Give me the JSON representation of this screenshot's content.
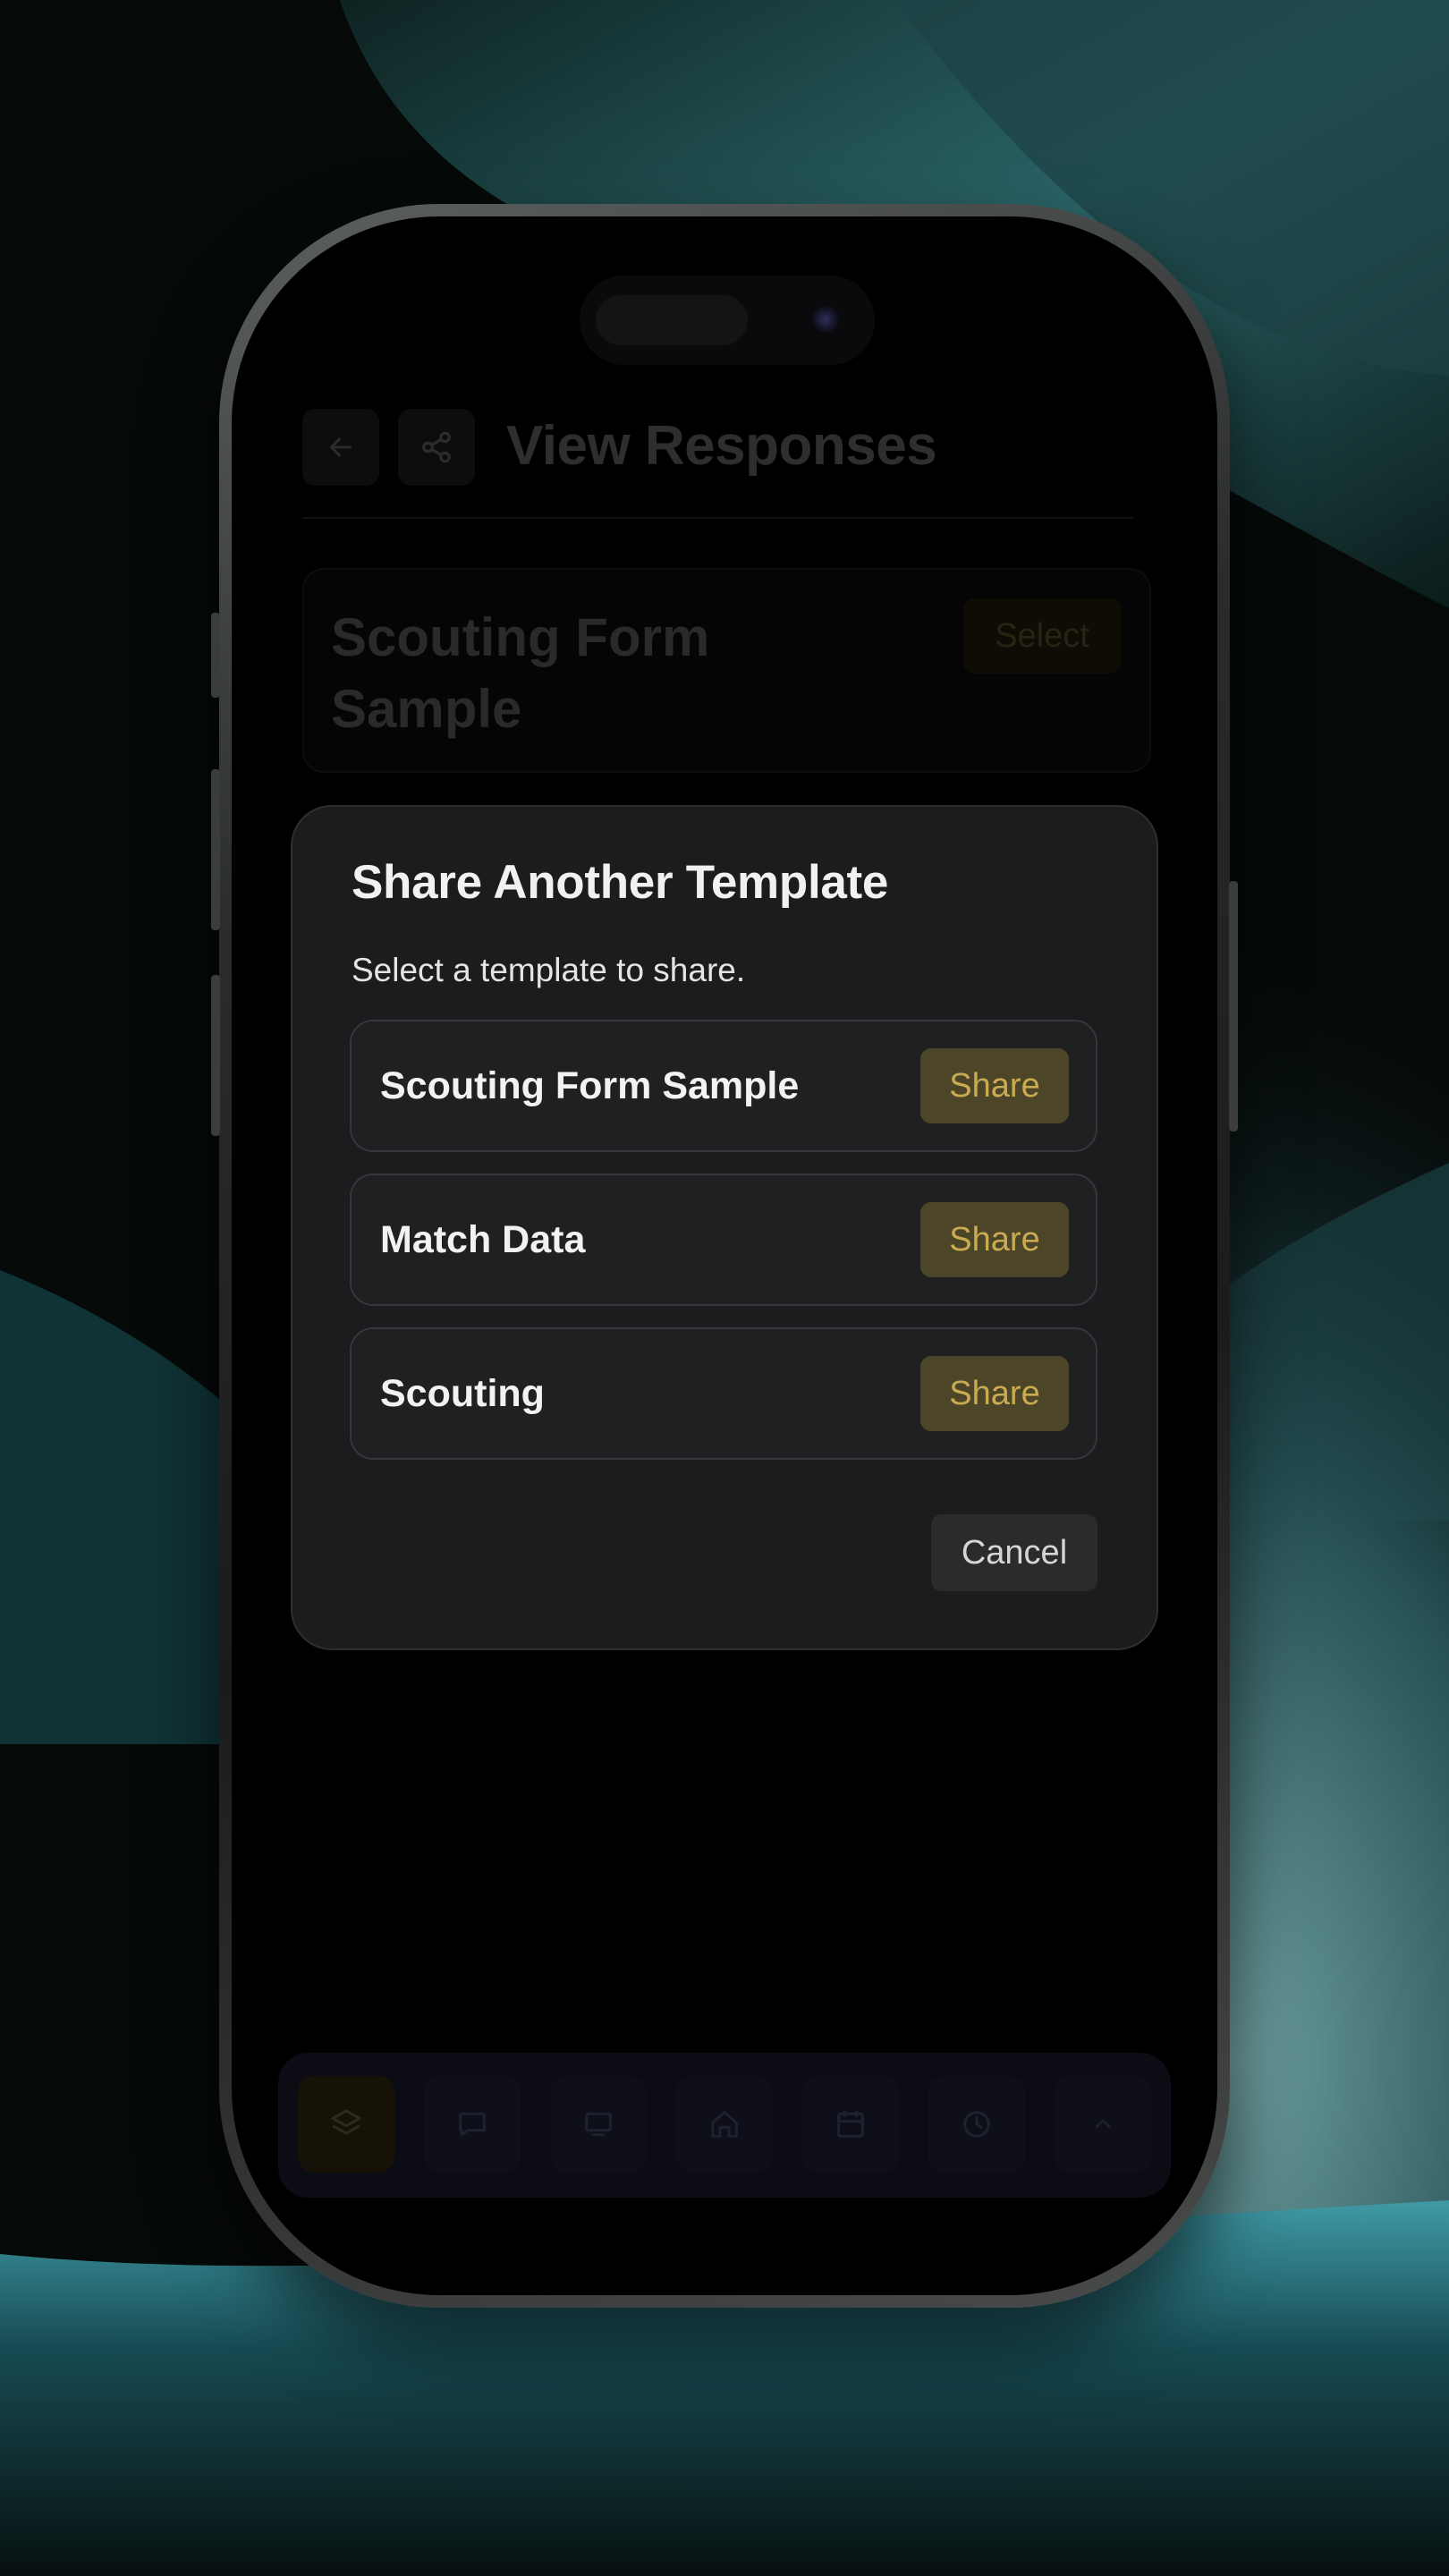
{
  "background_app": {
    "page_title": "View Responses",
    "back_icon": "arrow-left-icon",
    "share_icon": "share-icon",
    "card": {
      "title": "Scouting Form Sample",
      "select_label": "Select"
    }
  },
  "dialog": {
    "title": "Share Another Template",
    "description": "Select a template to share.",
    "templates": [
      {
        "name": "Scouting Form Sample",
        "action": "Share"
      },
      {
        "name": "Match Data",
        "action": "Share"
      },
      {
        "name": "Scouting",
        "action": "Share"
      }
    ],
    "cancel_label": "Cancel"
  },
  "tab_bar": {
    "items": [
      {
        "icon": "layers-icon",
        "active": true
      },
      {
        "icon": "chat-icon",
        "active": false
      },
      {
        "icon": "monitor-icon",
        "active": false
      },
      {
        "icon": "home-icon",
        "active": false
      },
      {
        "icon": "calendar-icon",
        "active": false
      },
      {
        "icon": "clock-icon",
        "active": false
      },
      {
        "icon": "chevron-up-icon",
        "active": false
      }
    ]
  },
  "colors": {
    "dialog_bg": "#1b1c1d",
    "share_button_bg": "#4d4528",
    "share_button_text": "#c9ac52",
    "wallpaper_accent": "#3a8c92"
  }
}
